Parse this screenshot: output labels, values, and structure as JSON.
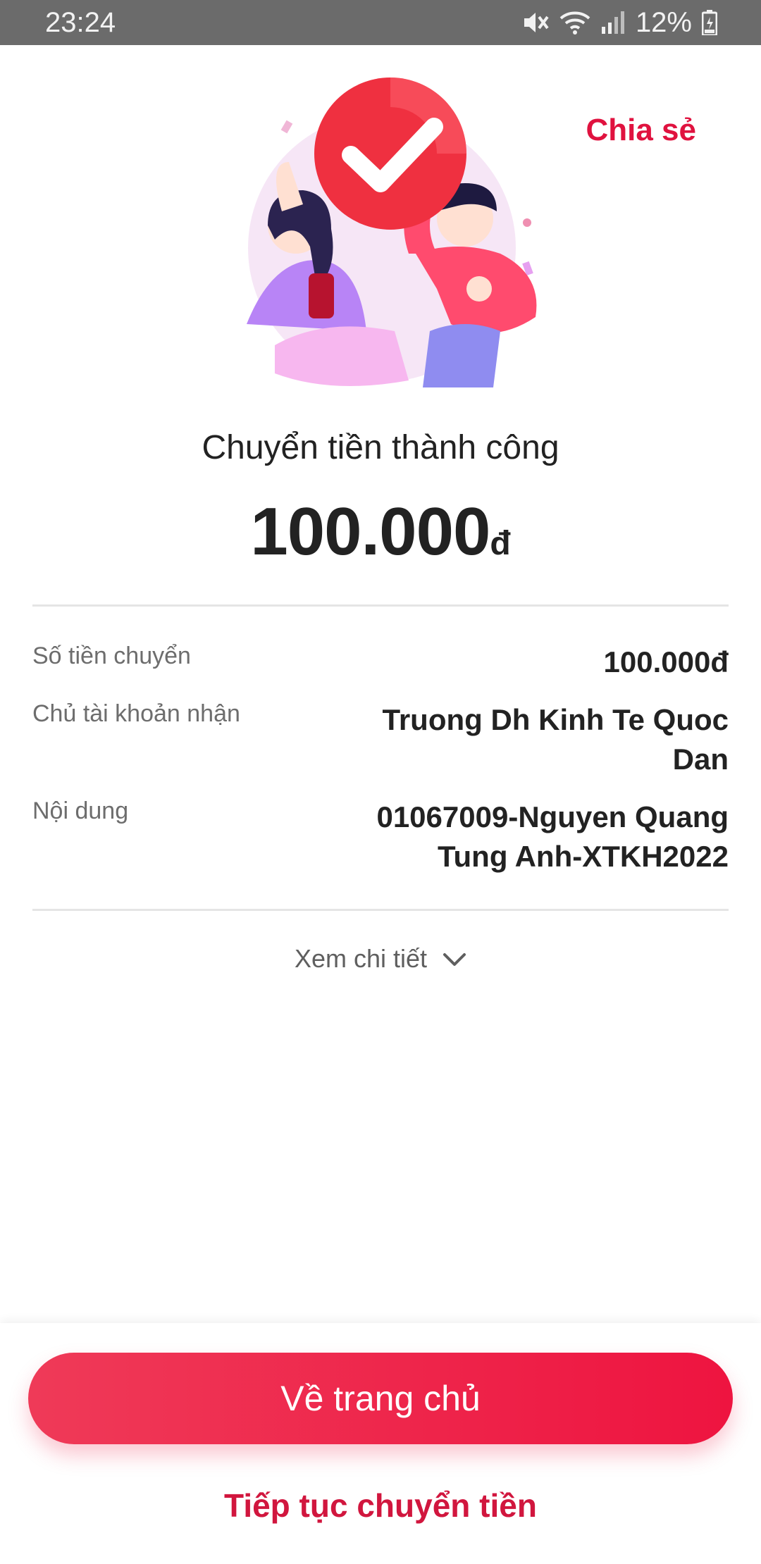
{
  "status_bar": {
    "time": "23:24",
    "battery": "12%",
    "icons": [
      "mute-icon",
      "wifi-icon",
      "signal-icon",
      "battery-icon"
    ]
  },
  "header": {
    "share_label": "Chia sẻ"
  },
  "result": {
    "title": "Chuyển tiền thành công",
    "amount": "100.000",
    "currency": "đ"
  },
  "details": [
    {
      "label": "Số tiền chuyển",
      "value": "100.000đ"
    },
    {
      "label": "Chủ tài khoản nhận",
      "value": "Truong Dh Kinh Te Quoc Dan"
    },
    {
      "label": "Nội dung",
      "value": "01067009-Nguyen Quang Tung Anh-XTKH2022"
    }
  ],
  "detail_toggle": {
    "label": "Xem chi tiết",
    "icon": "chevron-down-icon"
  },
  "footer": {
    "home_button": "Về trang chủ",
    "continue_link": "Tiếp tục chuyển tiền"
  },
  "colors": {
    "accent": "#E0123F",
    "button_start": "#EF3A58",
    "button_end": "#EE1440"
  }
}
